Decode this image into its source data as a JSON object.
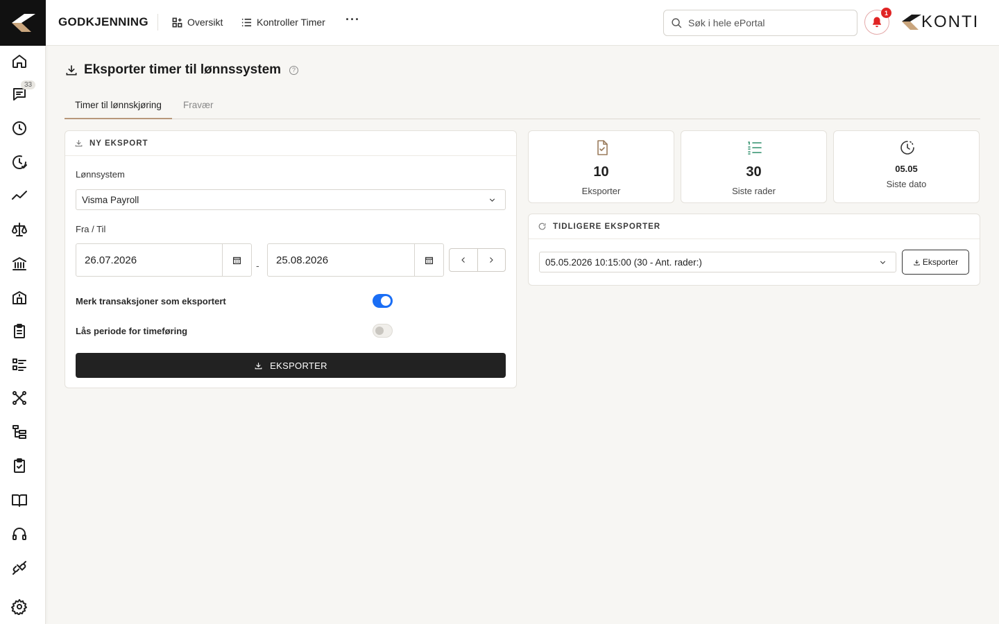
{
  "sidebar": {
    "badge_count": "33",
    "icons": [
      "home-icon",
      "chat-icon",
      "clock-icon",
      "clock-check-icon",
      "trend-icon",
      "scale-icon",
      "bank-icon",
      "building-icon",
      "clipboard-icon",
      "list-icon",
      "network-icon",
      "tree-icon",
      "clipboard-check-icon",
      "book-icon",
      "headset-icon",
      "plug-icon",
      "gear-icon"
    ]
  },
  "topbar": {
    "app_title": "GODKJENNING",
    "nav": [
      {
        "label": "Oversikt",
        "icon": "grid-add-icon"
      },
      {
        "label": "Kontroller Timer",
        "icon": "list-icon"
      }
    ],
    "more": "···",
    "search_placeholder": "Søk i hele ePortal",
    "notification_count": "1",
    "brand": "KONTI"
  },
  "page": {
    "title": "Eksporter timer til lønnssystem",
    "help": "?",
    "tabs": [
      {
        "label": "Timer til lønnskjøring",
        "active": true
      },
      {
        "label": "Fravær",
        "active": false
      }
    ]
  },
  "new_export": {
    "header": "NY EKSPORT",
    "system_label": "Lønnsystem",
    "system_value": "Visma Payroll",
    "period_label": "Fra / Til",
    "from_date": "26.07.2026",
    "separator": "-",
    "to_date": "25.08.2026",
    "mark_label": "Merk transaksjoner som eksportert",
    "mark_on": true,
    "lock_label": "Lås periode for timeføring",
    "lock_on": false,
    "export_button": "EKSPORTER"
  },
  "stats": [
    {
      "value": "10",
      "caption": "Eksporter",
      "icon": "file-check-icon",
      "color": "#9a7b5c"
    },
    {
      "value": "30",
      "caption": "Siste rader",
      "icon": "list-ordered-icon",
      "color": "#2f8f6b"
    },
    {
      "value": "05.05",
      "caption": "Siste dato",
      "icon": "clock-icon",
      "color": "#333333"
    }
  ],
  "previous": {
    "header": "TIDLIGERE EKSPORTER",
    "selected": "05.05.2026 10:15:00 (30 - Ant. rader:)",
    "button": "Eksporter"
  },
  "colors": {
    "accent_tab": "#b8977a",
    "toggle_on": "#1a6ef5",
    "notification": "#e02424",
    "primary_button": "#222222"
  }
}
